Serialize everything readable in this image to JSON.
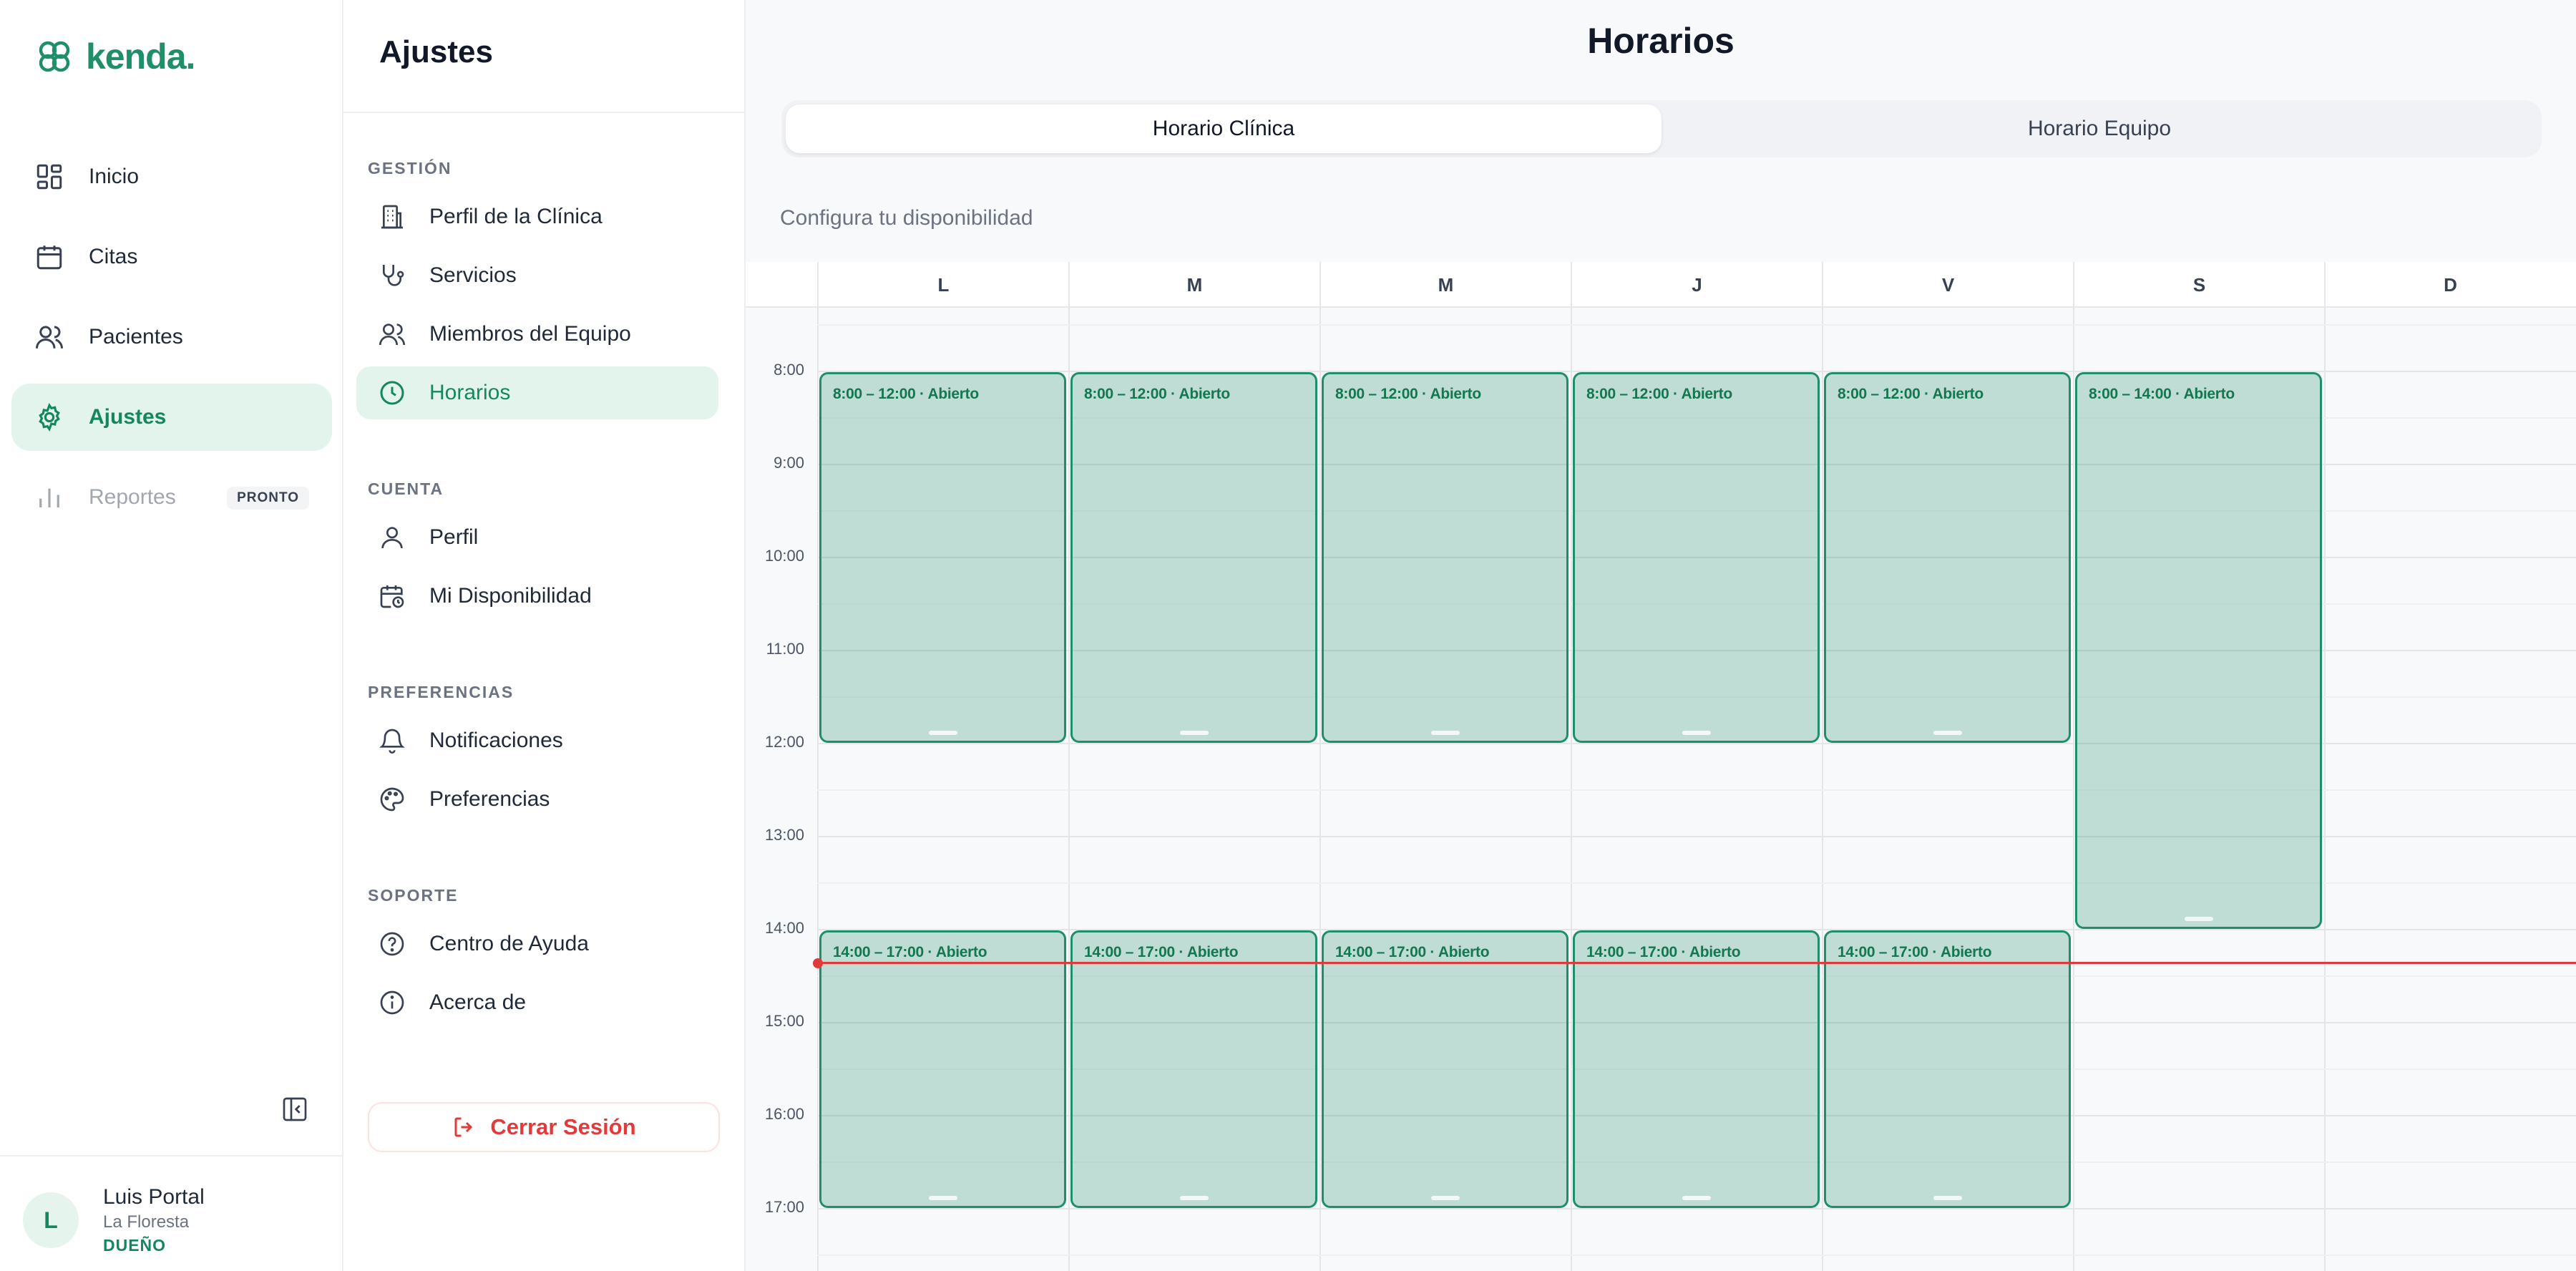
{
  "brand": {
    "name": "kenda."
  },
  "nav": {
    "items": [
      {
        "label": "Inicio",
        "icon": "grid-icon"
      },
      {
        "label": "Citas",
        "icon": "calendar-icon"
      },
      {
        "label": "Pacientes",
        "icon": "users-icon"
      },
      {
        "label": "Ajustes",
        "icon": "gear-icon",
        "active": true
      },
      {
        "label": "Reportes",
        "icon": "bar-chart-icon",
        "disabled": true,
        "badge": "PRONTO"
      }
    ]
  },
  "user": {
    "initial": "L",
    "name": "Luis Portal",
    "clinic": "La Floresta",
    "role": "DUEÑO"
  },
  "settings": {
    "title": "Ajustes",
    "sections": [
      {
        "label": "GESTIÓN",
        "items": [
          "Perfil de la Clínica",
          "Servicios",
          "Miembros del Equipo",
          "Horarios"
        ]
      },
      {
        "label": "CUENTA",
        "items": [
          "Perfil",
          "Mi Disponibilidad"
        ]
      },
      {
        "label": "PREFERENCIAS",
        "items": [
          "Notificaciones",
          "Preferencias"
        ]
      },
      {
        "label": "SOPORTE",
        "items": [
          "Centro de Ayuda",
          "Acerca de"
        ]
      }
    ],
    "logout_label": "Cerrar Sesión"
  },
  "main": {
    "title": "Horarios",
    "tabs": [
      {
        "label": "Horario Clínica",
        "active": true
      },
      {
        "label": "Horario Equipo"
      }
    ],
    "subtitle": "Configura tu disponibilidad"
  },
  "calendar": {
    "days": [
      "L",
      "M",
      "M",
      "J",
      "V",
      "S",
      "D"
    ],
    "hours": [
      "8:00",
      "9:00",
      "10:00",
      "11:00",
      "12:00",
      "13:00",
      "14:00",
      "15:00",
      "16:00",
      "17:00"
    ],
    "blocks": [
      {
        "day": 0,
        "start": 8,
        "end": 12,
        "label": "8:00 – 12:00 · Abierto"
      },
      {
        "day": 1,
        "start": 8,
        "end": 12,
        "label": "8:00 – 12:00 · Abierto"
      },
      {
        "day": 2,
        "start": 8,
        "end": 12,
        "label": "8:00 – 12:00 · Abierto"
      },
      {
        "day": 3,
        "start": 8,
        "end": 12,
        "label": "8:00 – 12:00 · Abierto"
      },
      {
        "day": 4,
        "start": 8,
        "end": 12,
        "label": "8:00 – 12:00 · Abierto"
      },
      {
        "day": 5,
        "start": 8,
        "end": 14,
        "label": "8:00 – 14:00 · Abierto"
      },
      {
        "day": 0,
        "start": 14,
        "end": 17,
        "label": "14:00 – 17:00 · Abierto"
      },
      {
        "day": 1,
        "start": 14,
        "end": 17,
        "label": "14:00 – 17:00 · Abierto"
      },
      {
        "day": 2,
        "start": 14,
        "end": 17,
        "label": "14:00 – 17:00 · Abierto"
      },
      {
        "day": 3,
        "start": 14,
        "end": 17,
        "label": "14:00 – 17:00 · Abierto"
      },
      {
        "day": 4,
        "start": 14,
        "end": 17,
        "label": "14:00 – 17:00 · Abierto"
      }
    ],
    "now_time": 14.35
  },
  "colors": {
    "accent": "#1f8f6a",
    "accent_bg": "#e3f4ec",
    "danger": "#e23a3a"
  }
}
